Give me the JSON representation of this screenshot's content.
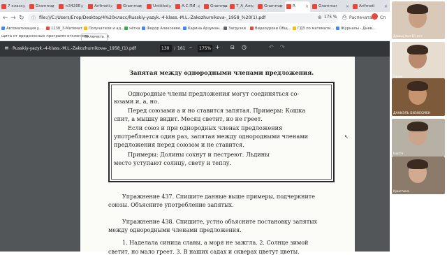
{
  "tabs": [
    {
      "title": "7 класс",
      "color": "#e8453c",
      "active": false
    },
    {
      "title": "Grammar",
      "color": "#e8453c",
      "active": false
    },
    {
      "title": "<3420E",
      "color": "#e8453c",
      "active": false
    },
    {
      "title": "Arifmeti",
      "color": "#e8453c",
      "active": false
    },
    {
      "title": "Grammar",
      "color": "#e8453c",
      "active": false
    },
    {
      "title": "Untitled",
      "color": "#e8453c",
      "active": false
    },
    {
      "title": "A.C.ПИ",
      "color": "#e8453c",
      "active": false
    },
    {
      "title": "Grammar",
      "color": "#e8453c",
      "active": false
    },
    {
      "title": "Т_А_Алг",
      "color": "#e8453c",
      "active": false
    },
    {
      "title": "Grammar",
      "color": "#e8453c",
      "active": false
    },
    {
      "title": "R",
      "color": "#e8453c",
      "active": true
    },
    {
      "title": "Grammar",
      "color": "#e8453c",
      "active": false
    },
    {
      "title": "Arifmeti",
      "color": "#e8453c",
      "active": false
    }
  ],
  "address_bar": {
    "url": "file:///C:/Users/Егор/Desktop/4%20класс/Russkiy-yazyk.-4-klass.-M.L.-Zakozhurnikova-_1958_%20(1).pdf",
    "zoom": "175 %",
    "print_label": "Распечатать",
    "extra_label": "Сп"
  },
  "bookmarks": [
    {
      "label": "Автоматизация у...",
      "color": "#4285f4"
    },
    {
      "label": "1138_3-Математ...",
      "color": "#e8453c"
    },
    {
      "label": "Получатели и ад...",
      "color": "#fbbc04"
    },
    {
      "label": "чётка",
      "color": "#34a853"
    },
    {
      "label": "Федор Алексееве...",
      "color": "#4285f4"
    },
    {
      "label": "Карина Арзуман...",
      "color": "#4285f4"
    },
    {
      "label": "Загрузки",
      "color": "#5f6368"
    },
    {
      "label": "Видеоуроки Общ...",
      "color": "#e8453c"
    },
    {
      "label": "ГДЗ по математи...",
      "color": "#fbbc04"
    },
    {
      "label": "Журналы - Днев...",
      "color": "#4285f4"
    }
  ],
  "infobar": {
    "text": "щита от вредоносных программ отключена",
    "button": "Включить"
  },
  "pdf_toolbar": {
    "filename": "Russkiy-yazyk.-4-klass.-M.L.-Zakozhurnikova-_1958_(1).pdf",
    "page_current": "130",
    "page_total": "161",
    "zoom": "175%",
    "minus": "–",
    "plus": "+"
  },
  "document": {
    "heading": "Запятая между однородными членами предложения.",
    "rule_box": [
      {
        "text": "Однородные члены предложения могут соединяться со-",
        "indent": true
      },
      {
        "text": "юзами и, а, но.",
        "indent": false
      },
      {
        "text": "Перед союзами а и но ставится запятая. Примеры: Кошка",
        "indent": true
      },
      {
        "text": "спит, а мышку видит. Месяц светит, но не греет.",
        "indent": false
      },
      {
        "text": "Если союз и при однородных членах предложения",
        "indent": true
      },
      {
        "text": "употребляется один раз, запятая между однородными членами",
        "indent": false
      },
      {
        "text": "предложения перед союзом и не ставится.",
        "indent": false
      },
      {
        "text": "Примеры: Долины сохнут и пестреют. Льдины",
        "indent": true
      },
      {
        "text": "место уступают солнцу, свету и теплу.",
        "indent": false
      }
    ],
    "exercises": [
      {
        "lines": [
          {
            "text": "Упражнение 437. Спишите данные выше примеры, подчеркните",
            "indent": true
          },
          {
            "text": "союзы. Объясните употребление запятых.",
            "indent": false
          }
        ]
      },
      {
        "lines": [
          {
            "text": "Упражнение 438. Спишите, устно объясните постановку запятых",
            "indent": true
          },
          {
            "text": "между однородными членами предложения.",
            "indent": false
          }
        ]
      },
      {
        "lines": [
          {
            "text": "1. Наделала синица славы, а моря не зажгла. 2. Солнце зимой",
            "indent": true
          },
          {
            "text": "светит, но мало греет. 3. В наших садах и скверах цветут цветы.",
            "indent": false
          }
        ]
      }
    ]
  },
  "participants": [
    {
      "label": "Давид 4кл 10 лет",
      "bg": "#d9c9b8",
      "face": "#c99f83"
    },
    {
      "label": "Ефим",
      "bg": "#e6ddd0",
      "face": "#b98a6e"
    },
    {
      "label": "ДАНИЭЛЬ БИЗНЕСМЕН",
      "bg": "#7c5a3a",
      "face": "#c8946f"
    },
    {
      "label": "Настя",
      "bg": "#b7b0a5",
      "face": "#caa48b"
    },
    {
      "label": "Кристина",
      "bg": "#8c7b6a",
      "face": "#d1aa90"
    }
  ],
  "colors": {
    "tabstrip": "#dee1e6",
    "pdf_toolbar": "#323639",
    "doc_background": "#525659",
    "page": "#fbfbf8"
  }
}
